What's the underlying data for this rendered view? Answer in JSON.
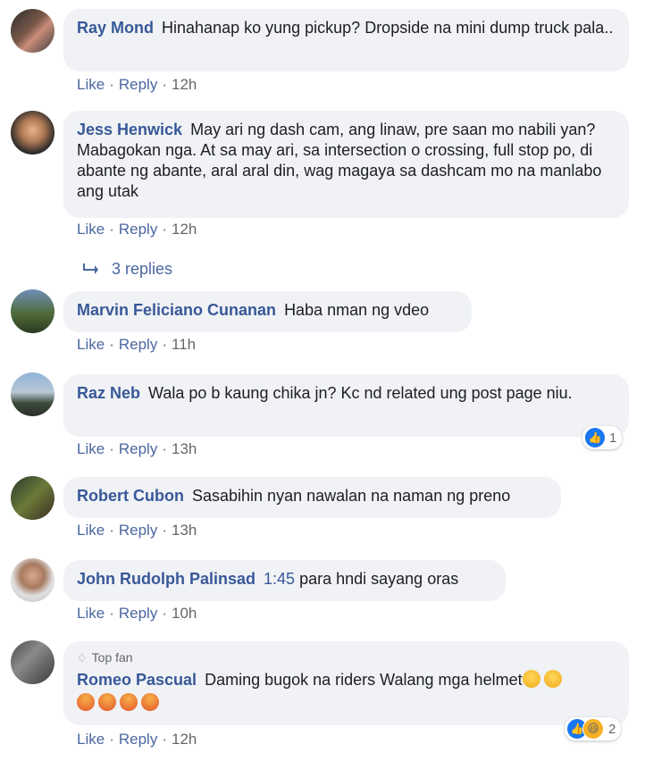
{
  "comments": [
    {
      "author": "Ray Mond",
      "text": "Hinahanap ko yung pickup? Dropside na mini dump truck pala..",
      "time": "12h"
    },
    {
      "author": "Jess Henwick",
      "text": "May ari ng dash cam, ang linaw, pre saan mo nabili yan? Mabagokan nga. At sa may ari, sa intersection o crossing, full stop po, di abante ng abante, aral aral din, wag magaya sa dashcam mo na manlabo ang utak",
      "time": "12h"
    },
    {
      "author": "Marvin Feliciano Cunanan",
      "text": "Haba nman ng vdeo",
      "time": "11h"
    },
    {
      "author": "Raz Neb",
      "text": "Wala po b kaung chika jn? Kc nd related ung post page niu.",
      "time": "13h",
      "reaction_count": "1"
    },
    {
      "author": "Robert Cubon",
      "text": "Sasabihin nyan nawalan na naman ng preno",
      "time": "13h"
    },
    {
      "author": "John Rudolph Palinsad",
      "timestamp_link": "1:45",
      "text": "para hndi sayang oras",
      "time": "10h"
    },
    {
      "author": "Romeo Pascual",
      "badge": "Top fan",
      "text": "Daming bugok na riders Walang mga helmet",
      "time": "12h",
      "reaction_count": "2"
    }
  ],
  "actions": {
    "like": "Like",
    "reply": "Reply",
    "separator": "·"
  },
  "replies_label": "3 replies",
  "colors": {
    "author": "#385898",
    "link": "#4b67a1",
    "bubble": "#f0f2f5",
    "meta": "#65676b",
    "like_blue": "#1877f2"
  }
}
